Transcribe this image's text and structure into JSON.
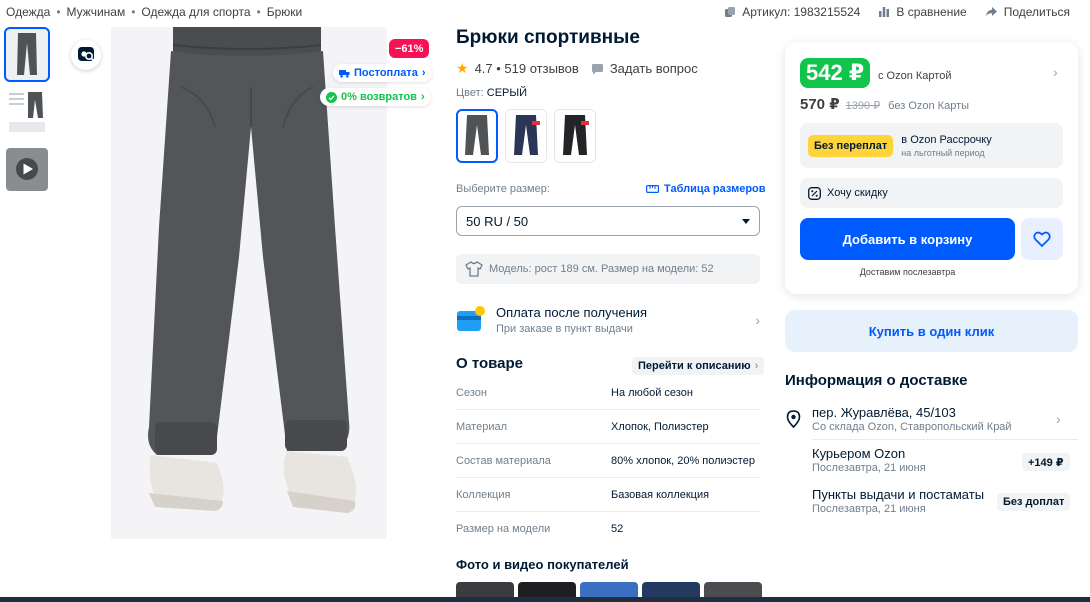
{
  "breadcrumbs": [
    "Одежда",
    "Мужчинам",
    "Одежда для спорта",
    "Брюки"
  ],
  "top_actions": {
    "article": "Артикул: 1983215524",
    "compare": "В сравнение",
    "share": "Поделиться"
  },
  "gallery": {
    "discount": "−61%",
    "postpay": "Постоплата",
    "returns": "0% возвратов"
  },
  "product": {
    "title": "Брюки спортивные",
    "rating": "4.7 • 519 отзывов",
    "ask": "Задать вопрос",
    "color_label": "Цвет: ",
    "color_value": "СЕРЫЙ"
  },
  "size": {
    "label": "Выберите размер:",
    "table_link": "Таблица размеров",
    "selected": "50 RU / 50",
    "model_info": "Модель: рост 189 см. Размер на модели: 52"
  },
  "payment": {
    "title": "Оплата после получения",
    "subtitle": "При заказе в пункт выдачи"
  },
  "about": {
    "title": "О товаре",
    "to_description": "Перейти к описанию",
    "specs": [
      {
        "k": "Сезон",
        "v": "На любой сезон"
      },
      {
        "k": "Материал",
        "v": "Хлопок, Полиэстер"
      },
      {
        "k": "Состав материала",
        "v": "80% хлопок, 20% полиэстер"
      },
      {
        "k": "Коллекция",
        "v": "Базовая коллекция"
      },
      {
        "k": "Размер на модели",
        "v": "52"
      }
    ]
  },
  "photos_title": "Фото и видео покупателей",
  "price": {
    "card_price": "542 ₽",
    "card_label": "с Ozon Картой",
    "price": "570 ₽",
    "old_price": "1390 ₽",
    "no_card_label": "без Ozon Карты",
    "installment_tag": "Без переплат",
    "installment_l1": "в Ozon Рассрочку",
    "installment_l2": "на льготный период",
    "want_discount": "Хочу скидку",
    "add_to_cart": "Добавить в корзину",
    "delivery_hint": "Доставим послезавтра",
    "one_click": "Купить в один клик"
  },
  "delivery": {
    "title": "Информация о доставке",
    "address": "пер. Журавлёва, 45/103",
    "warehouse": "Со склада Ozon, Ставропольский Край",
    "options": [
      {
        "name": "Курьером Ozon",
        "when": "Послезавтра, 21 июня",
        "badge": "+149 ₽"
      },
      {
        "name": "Пункты выдачи и постаматы",
        "when": "Послезавтра, 21 июня",
        "badge": "Без доплат"
      }
    ]
  },
  "colors": {
    "accent": "#005bff",
    "price_green": "#10c44c",
    "discount_pink": "#f91155",
    "installment_yellow": "#ffd43a"
  }
}
